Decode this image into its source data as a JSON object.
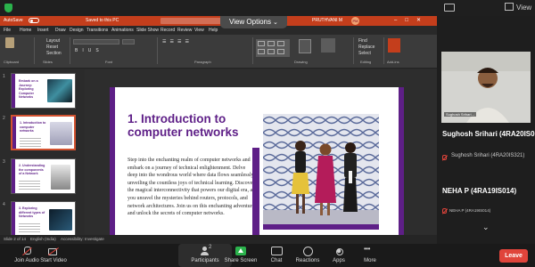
{
  "zoom": {
    "view_label": "View",
    "view_options_label": "View Options",
    "leave_label": "Leave"
  },
  "ppt": {
    "autosave_label": "AutoSave",
    "doc_title": "Saved to this PC",
    "user_name": "PRUTHVANI M",
    "menus": [
      "File",
      "Home",
      "Insert",
      "Draw",
      "Design",
      "Transitions",
      "Animations",
      "Slide Show",
      "Record",
      "Review",
      "View",
      "Help"
    ],
    "ribbon_groups": [
      "Clipboard",
      "Slides",
      "Font",
      "Paragraph",
      "Drawing",
      "Editing",
      "Add-ins"
    ],
    "ribbon_items": {
      "layout": "Layout",
      "reset": "Reset",
      "section": "Section",
      "find": "Find",
      "replace": "Replace",
      "select": "Select"
    },
    "thumbnails": [
      {
        "num": "1",
        "title": "Embark on a Journey: Exploring Computer Networks"
      },
      {
        "num": "2",
        "title": "1. Introduction to computer networks"
      },
      {
        "num": "3",
        "title": "2. Understanding the components of a Network"
      },
      {
        "num": "4",
        "title": "3. Exploring different types of Networks"
      }
    ],
    "status": {
      "slide_counter": "Slide 2 of 14",
      "language": "English (India)",
      "accessibility": "Accessibility: Investigate"
    }
  },
  "slide": {
    "title": "1. Introduction to computer networks",
    "body": "Step into the enchanting realm of computer networks and embark on a journey of technical enlightenment. Delve deep into the wondrous world where data flows seamlessly, unveiling the countless joys of technical learning. Discover the magical interconnectivity that powers our digital era, as you unravel the mysteries behind routers, protocols, and network architectures. Join us on this enchanting adventure and unlock the secrets of computer networks."
  },
  "participants": [
    {
      "display_name": "Sughosh Srihari (4RA20IS0...",
      "sub_name": "Sughosh Srihari (4RA20IS321)",
      "video_label": "Sughosh Srihari..."
    },
    {
      "display_name": "NEHA P (4RA19IS014)",
      "sub_name": "NEHA P (4RA19IS014)"
    }
  ],
  "toolbar": [
    {
      "label": "Join Audio",
      "icon": "microphone-muted-icon"
    },
    {
      "label": "Start Video",
      "icon": "camera-off-icon"
    },
    {
      "label": "Participants",
      "icon": "participants-icon",
      "badge": "2"
    },
    {
      "label": "Share Screen",
      "icon": "share-screen-icon"
    },
    {
      "label": "Chat",
      "icon": "chat-icon"
    },
    {
      "label": "Reactions",
      "icon": "reactions-icon"
    },
    {
      "label": "Apps",
      "icon": "apps-icon"
    },
    {
      "label": "More",
      "icon": "more-icon"
    }
  ],
  "colors": {
    "ppt_accent": "#c43e1c",
    "slide_purple": "#5e1f87",
    "zoom_green": "#2bb24c",
    "leave_red": "#e0443b"
  }
}
